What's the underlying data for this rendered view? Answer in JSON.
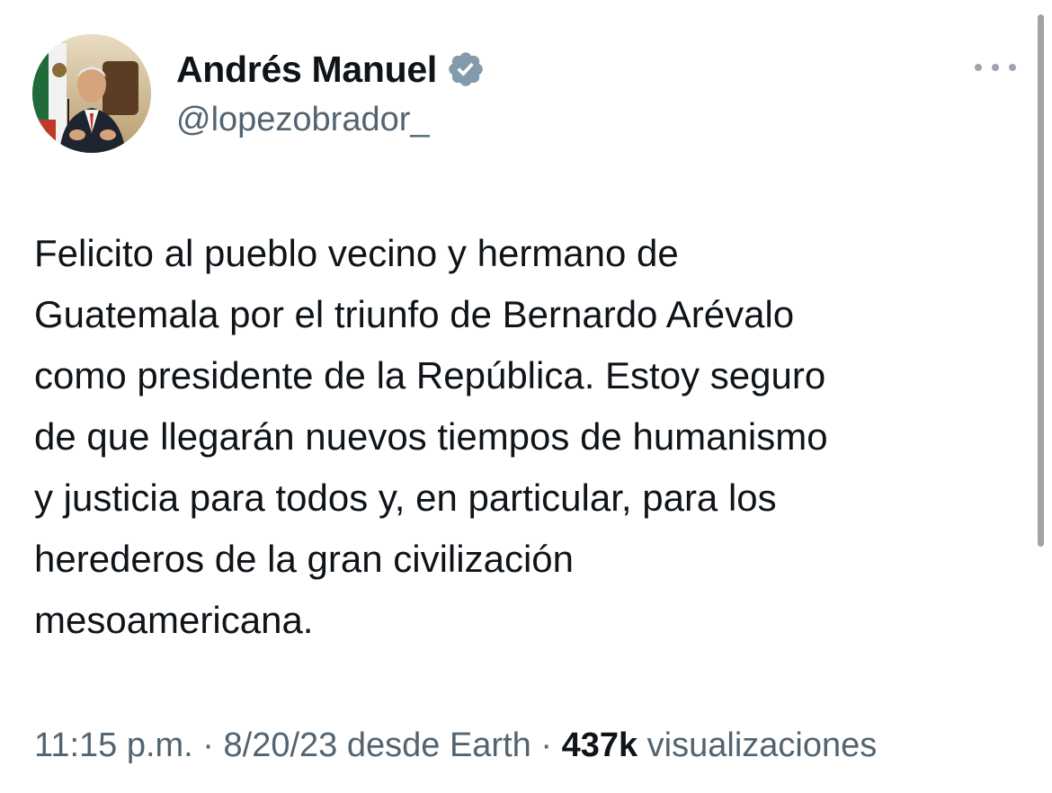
{
  "tweet": {
    "author": {
      "display_name": "Andrés Manuel",
      "handle": "@lopezobrador_",
      "verified": true,
      "avatar_icon": "profile-photo"
    },
    "more_icon": "more-options-icon",
    "text_lines": [
      "Felicito al pueblo vecino y hermano de",
      "Guatemala por el triunfo de Bernardo Arévalo",
      "como presidente de la República. Estoy seguro",
      "de que llegarán nuevos tiempos de humanismo",
      "y justicia para todos y, en particular, para los",
      "herederos de la gran civilización",
      "mesoamericana."
    ],
    "meta": {
      "time": "11:15 p.m.",
      "separator": " · ",
      "date_source": "8/20/23 desde Earth",
      "views_count": "437k",
      "views_label": " visualizaciones"
    }
  },
  "colors": {
    "text_primary": "#0f1419",
    "text_secondary": "#536471",
    "verified_badge": "#829aab",
    "background": "#ffffff"
  }
}
